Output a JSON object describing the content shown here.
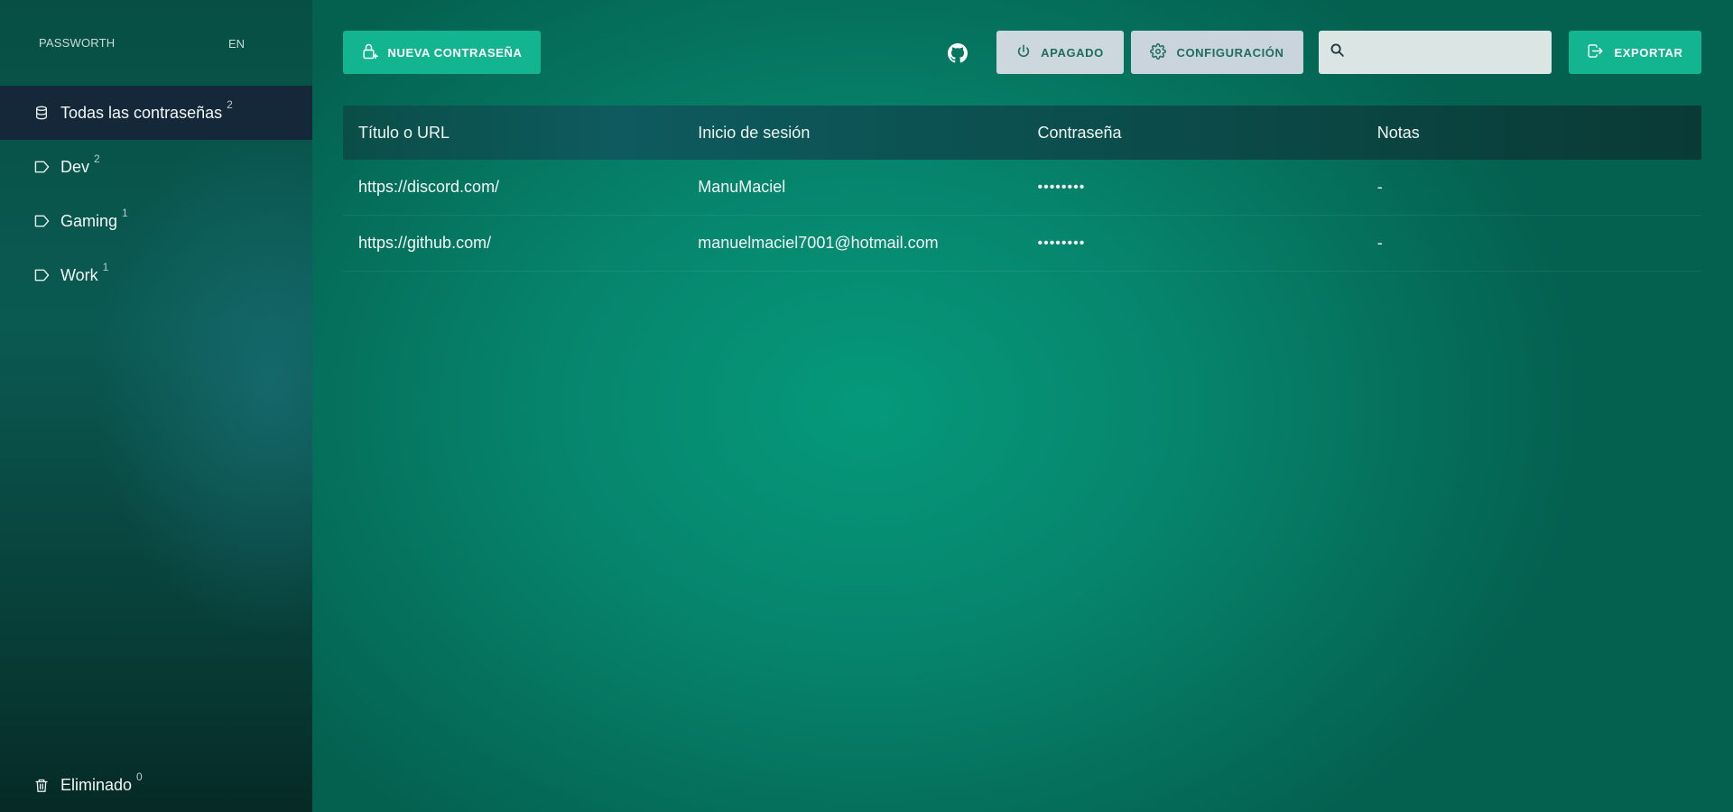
{
  "app": {
    "brand": "PASSWORTH",
    "lang": "EN"
  },
  "sidebar": {
    "items": [
      {
        "label": "Todas las contraseñas",
        "count": "2",
        "icon": "database-icon"
      },
      {
        "label": "Dev",
        "count": "2",
        "icon": "tag-icon"
      },
      {
        "label": "Gaming",
        "count": "1",
        "icon": "tag-icon"
      },
      {
        "label": "Work",
        "count": "1",
        "icon": "tag-icon"
      }
    ],
    "deleted": {
      "label": "Eliminado",
      "count": "0",
      "icon": "trash-icon"
    }
  },
  "toolbar": {
    "new_password": "NUEVA CONTRASEÑA",
    "power": "APAGADO",
    "settings": "CONFIGURACIÓN",
    "search_value": "",
    "export": "EXPORTAR"
  },
  "table": {
    "headers": [
      "Título o URL",
      "Inicio de sesión",
      "Contraseña",
      "Notas"
    ],
    "rows": [
      {
        "title": "https://discord.com/",
        "login": "ManuMaciel",
        "password": "••••••••",
        "notes": "-"
      },
      {
        "title": "https://github.com/",
        "login": "manuelmaciel7001@hotmail.com",
        "password": "••••••••",
        "notes": "-"
      }
    ]
  },
  "colors": {
    "accent": "#12b58f",
    "background": "#05997a",
    "sidebar_active": "#14283a",
    "button_grey": "#ccd8de"
  }
}
